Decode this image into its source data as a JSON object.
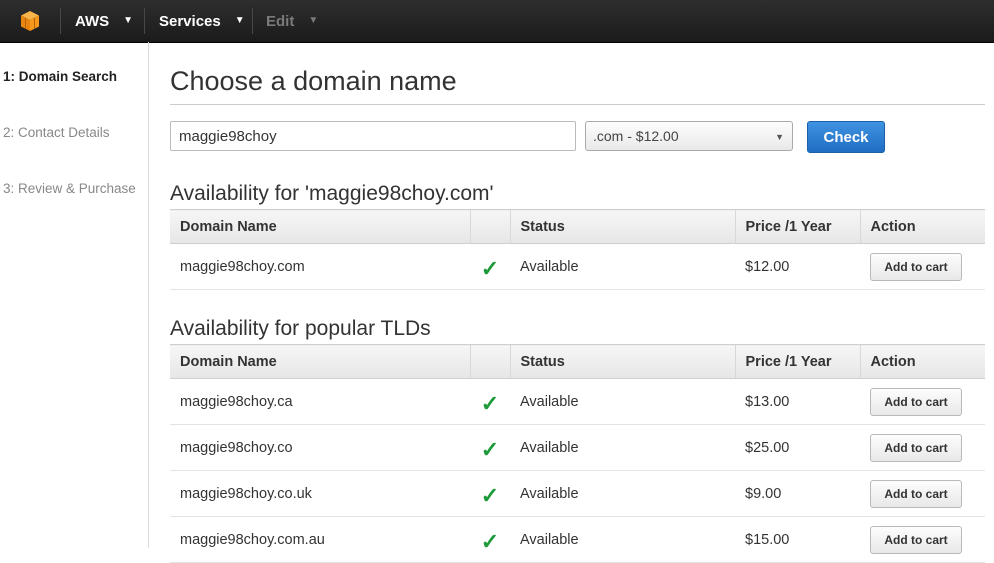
{
  "nav": {
    "logo_icon": "aws-cube-icon",
    "aws_label": "AWS",
    "services_label": "Services",
    "edit_label": "Edit",
    "accent_color": "#f7981d"
  },
  "sidebar": {
    "steps": [
      {
        "label": "1: Domain Search",
        "active": true
      },
      {
        "label": "2: Contact Details",
        "active": false
      },
      {
        "label": "3: Review & Purchase",
        "active": false
      }
    ]
  },
  "main": {
    "title": "Choose a domain name",
    "search": {
      "value": "maggie98choy"
    },
    "tld_select": {
      "selected": ".com - $12.00"
    },
    "check_label": "Check"
  },
  "availability": {
    "title": "Availability for 'maggie98choy.com'",
    "columns": [
      "Domain Name",
      "",
      "Status",
      "Price /1 Year",
      "Action"
    ],
    "rows": [
      {
        "domain": "maggie98choy.com",
        "status": "Available",
        "price": "$12.00",
        "action": "Add to cart"
      }
    ]
  },
  "popular": {
    "title": "Availability for popular TLDs",
    "columns": [
      "Domain Name",
      "",
      "Status",
      "Price /1 Year",
      "Action"
    ],
    "rows": [
      {
        "domain": "maggie98choy.ca",
        "status": "Available",
        "price": "$13.00",
        "action": "Add to cart"
      },
      {
        "domain": "maggie98choy.co",
        "status": "Available",
        "price": "$25.00",
        "action": "Add to cart"
      },
      {
        "domain": "maggie98choy.co.uk",
        "status": "Available",
        "price": "$9.00",
        "action": "Add to cart"
      },
      {
        "domain": "maggie98choy.com.au",
        "status": "Available",
        "price": "$15.00",
        "action": "Add to cart"
      }
    ]
  },
  "colors": {
    "check_green": "#1f9a3a",
    "primary_blue": "#2a7bd0"
  }
}
